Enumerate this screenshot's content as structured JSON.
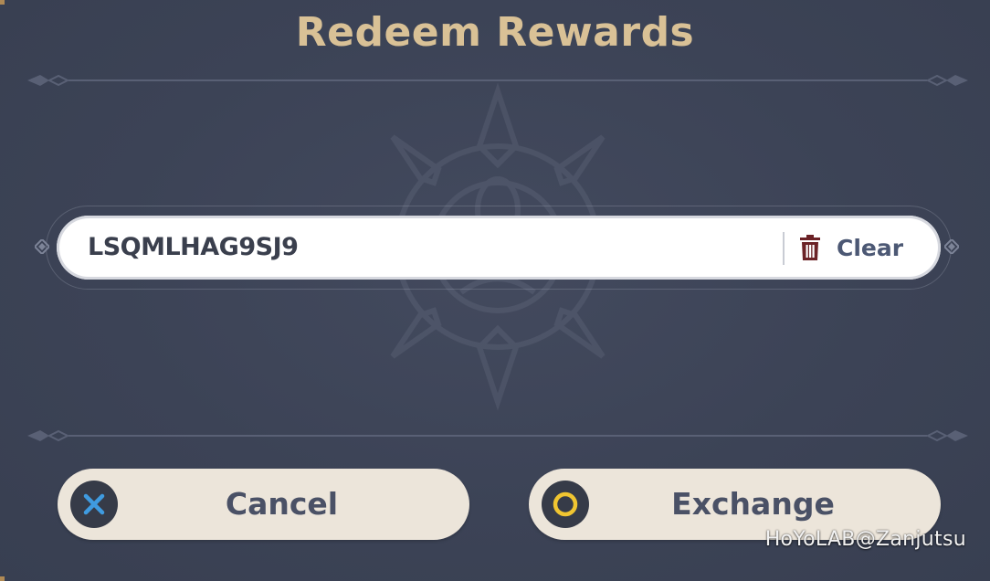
{
  "dialog": {
    "title": "Redeem Rewards"
  },
  "redeem_field": {
    "value": "LSQMLHAG9SJ9",
    "clear_label": "Clear",
    "clear_icon": "trash-icon"
  },
  "actions": {
    "cancel_label": "Cancel",
    "cancel_icon": "x-circle-icon",
    "exchange_label": "Exchange",
    "exchange_icon": "o-circle-icon"
  },
  "watermark": {
    "text": "HoYoLAB@Zanjutsu"
  },
  "colors": {
    "background": "#3c4356",
    "title_gold": "#d9c196",
    "button_cream": "#ece5da",
    "cancel_icon_blue": "#3f9be0",
    "exchange_icon_yellow": "#f0c531",
    "trash_red": "#6b2226",
    "clear_text": "#4c5874"
  }
}
